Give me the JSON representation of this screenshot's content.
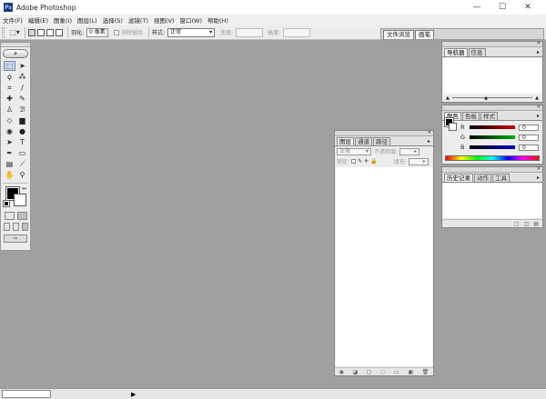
{
  "window": {
    "app_icon": "Ps",
    "title": "Adobe Photoshop",
    "minimize": "—",
    "maximize": "☐",
    "close": "✕"
  },
  "menu": [
    "文件(F)",
    "编辑(E)",
    "图象(I)",
    "图层(L)",
    "选择(S)",
    "滤镜(T)",
    "视图(V)",
    "窗口(W)",
    "帮助(H)"
  ],
  "options": {
    "tool_icon": "marquee-icon",
    "feather_label": "羽化:",
    "feather_value": "0 像素",
    "antialias_label": "消除锯齿",
    "style_label": "样式:",
    "style_value": "正常",
    "width_label": "宽度:",
    "height_label": "高度:"
  },
  "well_tabs": [
    "文件浏览",
    "画笔"
  ],
  "toolbox": {
    "logo": "✈",
    "tools": [
      {
        "name": "marquee-icon",
        "glyph": "⬚",
        "active": true
      },
      {
        "name": "move-icon",
        "glyph": "➤",
        "active": false
      },
      {
        "name": "lasso-icon",
        "glyph": "ϙ",
        "active": false
      },
      {
        "name": "magic-wand-icon",
        "glyph": "⁂",
        "active": false
      },
      {
        "name": "crop-icon",
        "glyph": "⌗",
        "active": false
      },
      {
        "name": "slice-icon",
        "glyph": "∕",
        "active": false
      },
      {
        "name": "healing-brush-icon",
        "glyph": "✚",
        "active": false
      },
      {
        "name": "brush-icon",
        "glyph": "✎",
        "active": false
      },
      {
        "name": "stamp-icon",
        "glyph": "♙",
        "active": false
      },
      {
        "name": "history-brush-icon",
        "glyph": "ℬ",
        "active": false
      },
      {
        "name": "eraser-icon",
        "glyph": "◇",
        "active": false
      },
      {
        "name": "gradient-icon",
        "glyph": "▆",
        "active": false
      },
      {
        "name": "blur-icon",
        "glyph": "◉",
        "active": false
      },
      {
        "name": "dodge-icon",
        "glyph": "●",
        "active": false
      },
      {
        "name": "path-select-icon",
        "glyph": "➤",
        "active": false
      },
      {
        "name": "type-icon",
        "glyph": "T",
        "active": false
      },
      {
        "name": "pen-icon",
        "glyph": "✒",
        "active": false
      },
      {
        "name": "shape-icon",
        "glyph": "▭",
        "active": false
      },
      {
        "name": "notes-icon",
        "glyph": "▤",
        "active": false
      },
      {
        "name": "eyedropper-icon",
        "glyph": "⟋",
        "active": false
      },
      {
        "name": "hand-icon",
        "glyph": "✋",
        "active": false
      },
      {
        "name": "zoom-icon",
        "glyph": "⚲",
        "active": false
      }
    ],
    "swap_glyph": "↔",
    "jump_glyph": "⇨"
  },
  "navigator_panel": {
    "tabs": [
      "导航器",
      "信息"
    ],
    "menu_glyph": "▸"
  },
  "color_panel": {
    "tabs": [
      "颜色",
      "色板",
      "样式"
    ],
    "menu_glyph": "▸",
    "rows": [
      {
        "label": "R",
        "value": "0",
        "color": "#d00000"
      },
      {
        "label": "G",
        "value": "0",
        "color": "#00b000"
      },
      {
        "label": "B",
        "value": "0",
        "color": "#0000d0"
      }
    ]
  },
  "history_panel": {
    "tabs": [
      "历史记录",
      "动作",
      "工具"
    ],
    "menu_glyph": "▸"
  },
  "layers_panel": {
    "tabs": [
      "图层",
      "通道",
      "路径"
    ],
    "menu_glyph": "▸",
    "blend_mode": "正常",
    "opacity_label": "不透明度:",
    "lock_label": "锁定:",
    "fill_label": "填充:",
    "footer_icons": [
      "◉",
      "◪",
      "▢",
      "◌",
      "▭",
      "▣",
      "🗑"
    ]
  },
  "colors": {
    "accent": "#6d8bb1",
    "workspace": "#a0a0a0"
  }
}
